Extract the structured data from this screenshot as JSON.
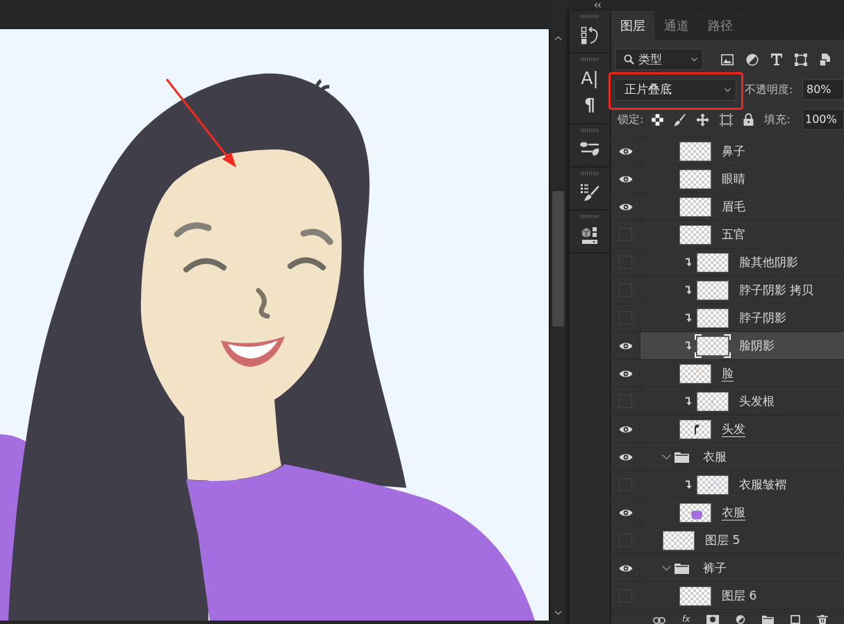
{
  "dock": [
    {
      "tools": [
        {
          "kind": "history"
        }
      ]
    },
    {
      "tools": [
        {
          "kind": "character",
          "text": "A|"
        },
        {
          "kind": "paragraph",
          "text": "¶"
        }
      ]
    },
    {
      "tools": [
        {
          "kind": "brush_settings"
        }
      ]
    },
    {
      "tools": [
        {
          "kind": "brush_presets"
        }
      ]
    },
    {
      "tools": [
        {
          "kind": "cube"
        }
      ]
    }
  ],
  "panel": {
    "tabs": [
      {
        "label": "图层",
        "selected": true
      },
      {
        "label": "通道",
        "selected": false
      },
      {
        "label": "路径",
        "selected": false
      }
    ],
    "filter": {
      "value": "类型"
    },
    "blend_mode": {
      "value": "正片叠底"
    },
    "opacity": {
      "label": "不透明度:",
      "value": "80%"
    },
    "lock": {
      "label": "锁定:"
    },
    "fill": {
      "label": "填充:",
      "value": "100%"
    },
    "layers": [
      {
        "kind": "continued",
        "children": [
          {
            "kind": "layer",
            "name": "鼻子",
            "visible": true,
            "clipped": false,
            "clip_base": false,
            "selected": false,
            "thumbnail": {
              "kind": "empty"
            }
          },
          {
            "kind": "layer",
            "name": "眼睛",
            "visible": true,
            "clipped": false,
            "clip_base": false,
            "selected": false,
            "thumbnail": {
              "kind": "empty"
            }
          },
          {
            "kind": "layer",
            "name": "眉毛",
            "visible": true,
            "clipped": false,
            "clip_base": false,
            "selected": false,
            "thumbnail": {
              "kind": "empty"
            }
          },
          {
            "kind": "layer",
            "name": "五官",
            "visible": false,
            "clipped": false,
            "clip_base": false,
            "selected": false,
            "thumbnail": {
              "kind": "empty"
            }
          },
          {
            "kind": "layer",
            "name": "脸其他阴影",
            "visible": false,
            "clipped": true,
            "clip_base": false,
            "selected": false,
            "thumbnail": {
              "kind": "empty"
            }
          },
          {
            "kind": "layer",
            "name": "脖子阴影 拷贝",
            "visible": false,
            "clipped": true,
            "clip_base": false,
            "selected": false,
            "thumbnail": {
              "kind": "empty"
            }
          },
          {
            "kind": "layer",
            "name": "脖子阴影",
            "visible": false,
            "clipped": true,
            "clip_base": false,
            "selected": false,
            "thumbnail": {
              "kind": "empty"
            }
          },
          {
            "kind": "layer",
            "name": "脸阴影",
            "visible": true,
            "clipped": true,
            "clip_base": false,
            "selected": true,
            "thumbnail": {
              "kind": "empty"
            }
          },
          {
            "kind": "layer",
            "name": "脸",
            "visible": true,
            "clipped": false,
            "clip_base": true,
            "selected": false,
            "thumbnail": {
              "kind": "skin"
            }
          },
          {
            "kind": "layer",
            "name": "头发根",
            "visible": false,
            "clipped": true,
            "clip_base": false,
            "selected": false,
            "thumbnail": {
              "kind": "strand"
            }
          },
          {
            "kind": "layer",
            "name": "头发",
            "visible": true,
            "clipped": false,
            "clip_base": true,
            "selected": false,
            "thumbnail": {
              "kind": "hair"
            }
          }
        ]
      },
      {
        "kind": "group",
        "name": "衣服",
        "visible": true,
        "expanded": true,
        "selected": false,
        "children": [
          {
            "kind": "layer",
            "name": "衣服皱褶",
            "visible": false,
            "clipped": true,
            "clip_base": false,
            "selected": false,
            "thumbnail": {
              "kind": "folds"
            }
          },
          {
            "kind": "layer",
            "name": "衣服",
            "visible": true,
            "clipped": false,
            "clip_base": true,
            "selected": false,
            "thumbnail": {
              "kind": "shirt"
            }
          }
        ]
      },
      {
        "kind": "layer",
        "name": "图层 5",
        "visible": false,
        "clipped": false,
        "clip_base": false,
        "selected": false,
        "thumbnail": {
          "kind": "empty"
        }
      },
      {
        "kind": "group",
        "name": "裤子",
        "visible": true,
        "expanded": true,
        "selected": false,
        "children": [
          {
            "kind": "layer",
            "name": "图层 6",
            "visible": false,
            "clipped": false,
            "clip_base": false,
            "selected": false,
            "thumbnail": {
              "kind": "empty"
            }
          }
        ]
      }
    ],
    "actions": [
      {
        "kind": "link"
      },
      {
        "kind": "text",
        "text": "fx"
      },
      {
        "kind": "mask"
      },
      {
        "kind": "adjustment"
      },
      {
        "kind": "folder"
      },
      {
        "kind": "new"
      },
      {
        "kind": "trash"
      }
    ]
  }
}
